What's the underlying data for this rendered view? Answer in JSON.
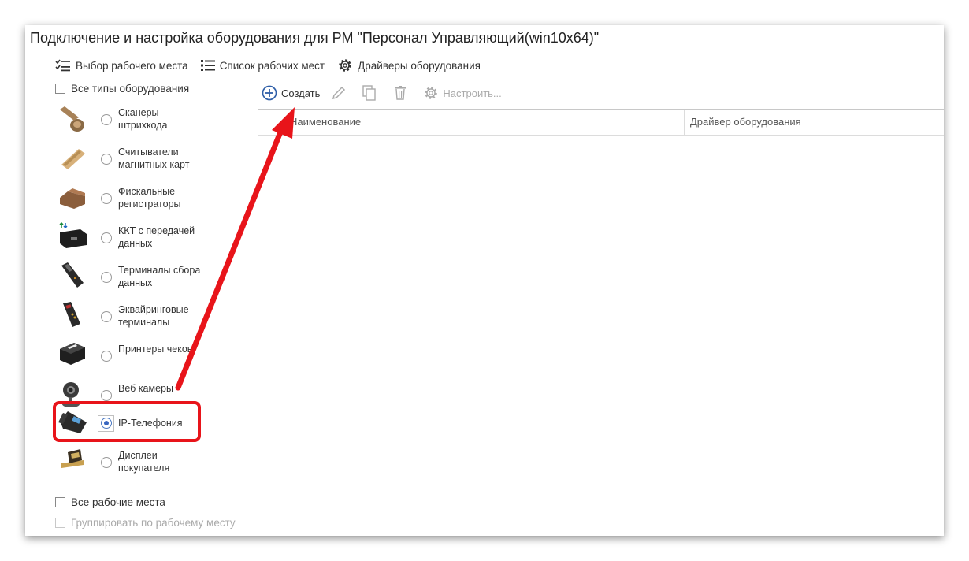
{
  "window": {
    "title": "Подключение и настройка оборудования для РМ \"Персонал Управляющий(win10x64)\""
  },
  "topbar": {
    "items": [
      {
        "label": "Выбор рабочего места",
        "icon": "checklist-icon"
      },
      {
        "label": "Список рабочих мест",
        "icon": "list-icon"
      },
      {
        "label": "Драйверы оборудования",
        "icon": "gear-icon"
      }
    ]
  },
  "filters": {
    "all_types": "Все типы оборудования",
    "all_workplaces": "Все рабочие места",
    "group_by_workplace": "Группировать по рабочему месту"
  },
  "equipment": [
    {
      "label": "Сканеры штрихкода",
      "icon": "barcode-scanner-icon",
      "selected": false
    },
    {
      "label": "Считыватели магнитных карт",
      "icon": "card-reader-icon",
      "selected": false
    },
    {
      "label": "Фискальные регистраторы",
      "icon": "fiscal-register-icon",
      "selected": false
    },
    {
      "label": "ККТ с передачей данных",
      "icon": "online-kkt-icon",
      "selected": false
    },
    {
      "label": "Терминалы сбора данных",
      "icon": "data-terminal-icon",
      "selected": false
    },
    {
      "label": "Эквайринговые терминалы",
      "icon": "acquiring-terminal-icon",
      "selected": false
    },
    {
      "label": "Принтеры чеков",
      "icon": "receipt-printer-icon",
      "selected": false
    },
    {
      "label": "Веб камеры",
      "icon": "webcam-icon",
      "selected": false
    },
    {
      "label": "IP-Телефония",
      "icon": "ip-phone-icon",
      "selected": true
    },
    {
      "label": "Дисплеи покупателя",
      "icon": "customer-display-icon",
      "selected": false
    }
  ],
  "commands": {
    "create": "Создать",
    "configure": "Настроить..."
  },
  "table": {
    "columns": [
      "Наименование",
      "Драйвер оборудования"
    ]
  },
  "colors": {
    "annotation": "#e8141a",
    "accent": "#3866c0"
  }
}
